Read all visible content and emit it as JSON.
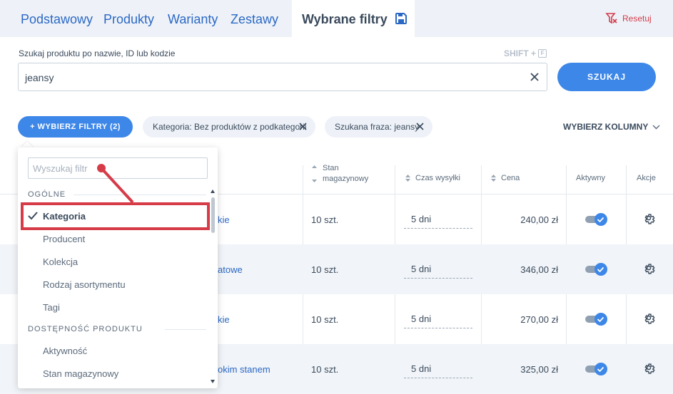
{
  "tabs": [
    {
      "label": "Podstawowy"
    },
    {
      "label": "Produkty"
    },
    {
      "label": "Warianty"
    },
    {
      "label": "Zestawy"
    },
    {
      "label": "Wybrane filtry"
    }
  ],
  "reset_label": "Resetuj",
  "search": {
    "label": "Szukaj produktu po nazwie, ID lub kodzie",
    "shortcut_text": "SHIFT +",
    "shortcut_key": "F",
    "value": "jeansy",
    "button_label": "SZUKAJ"
  },
  "filters": {
    "choose_label": "+ WYBIERZ FILTRY (2)",
    "chips": [
      {
        "label": "Kategoria: Bez produktów z podkategorii"
      },
      {
        "label": "Szukana fraza: jeansy"
      }
    ],
    "choose_columns_label": "WYBIERZ KOLUMNY"
  },
  "table": {
    "headers": {
      "stock_line1": "Stan",
      "stock_line2": "magazynowy",
      "shipping": "Czas wysyłki",
      "price": "Cena",
      "active": "Aktywny",
      "actions": "Akcje"
    },
    "rows": [
      {
        "name_fragment": "kie",
        "stock": "10 szt.",
        "shipping": "5 dni",
        "price": "240,00 zł",
        "active": true
      },
      {
        "name_fragment": "atowe",
        "stock": "10 szt.",
        "shipping": "5 dni",
        "price": "346,00 zł",
        "active": true
      },
      {
        "name_fragment": "kie",
        "stock": "10 szt.",
        "shipping": "5 dni",
        "price": "270,00 zł",
        "active": true
      },
      {
        "name_fragment": "okim stanem",
        "stock": "10 szt.",
        "shipping": "5 dni",
        "price": "325,00 zł",
        "active": true
      }
    ]
  },
  "dropdown": {
    "search_placeholder": "Wyszukaj filtr",
    "groups": [
      {
        "label": "OGÓLNE",
        "options": [
          {
            "label": "Kategoria",
            "selected": true
          },
          {
            "label": "Producent"
          },
          {
            "label": "Kolekcja"
          },
          {
            "label": "Rodzaj asortymentu"
          },
          {
            "label": "Tagi"
          }
        ]
      },
      {
        "label": "DOSTĘPNOŚĆ PRODUKTU",
        "options": [
          {
            "label": "Aktywność"
          },
          {
            "label": "Stan magazynowy"
          }
        ]
      }
    ]
  },
  "colors": {
    "accent": "#3d87e8",
    "link": "#2b68c4",
    "annotation": "#d63b48",
    "reset": "#d43b4a"
  }
}
